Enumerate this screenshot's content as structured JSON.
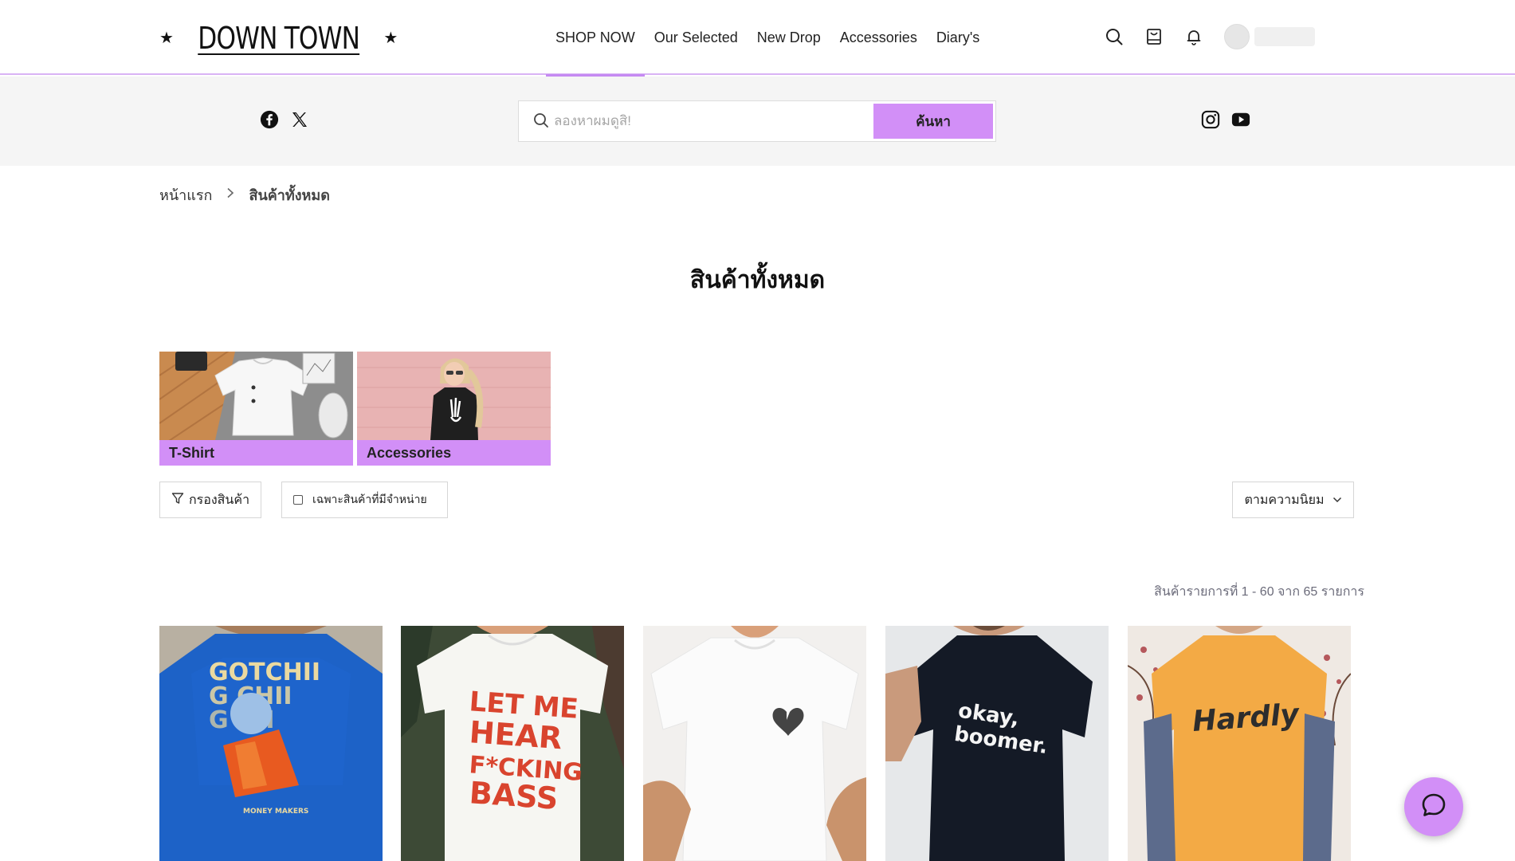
{
  "brand": {
    "logo_text": "DOWN TOWN",
    "star": "★"
  },
  "nav": {
    "items": [
      {
        "label": "SHOP NOW",
        "active": true
      },
      {
        "label": "Our Selected",
        "active": false
      },
      {
        "label": "New Drop",
        "active": false
      },
      {
        "label": "Accessories",
        "active": false
      },
      {
        "label": "Diary's",
        "active": false
      }
    ],
    "accent": "#c58af2"
  },
  "header_icons": [
    "search-icon",
    "cart-icon",
    "bell-icon"
  ],
  "search": {
    "placeholder": "ลองหาผมดูสิ!",
    "button_label": "ค้นหา"
  },
  "social": {
    "left": [
      "facebook-icon",
      "x-icon"
    ],
    "right": [
      "instagram-icon",
      "youtube-icon"
    ]
  },
  "breadcrumb": {
    "home": "หน้าแรก",
    "current": "สินค้าทั้งหมด"
  },
  "page_title": "สินค้าทั้งหมด",
  "categories": [
    {
      "label": "T-Shirt"
    },
    {
      "label": "Accessories"
    }
  ],
  "filters": {
    "filter_label": "กรองสินค้า",
    "in_stock_label": "เฉพาะสินค้าที่มีจำหน่าย",
    "sort_label": "ตามความนิยม"
  },
  "result_count": "สินค้ารายการที่ 1 - 60 จาก 65 รายการ",
  "products": [
    {
      "image": "blue-gotchii-tee",
      "print": "GOTCHII"
    },
    {
      "image": "white-bass-tee",
      "print": "LET ME HEAR BASS"
    },
    {
      "image": "white-heart-tee",
      "print": ""
    },
    {
      "image": "black-okay-boomer-tee",
      "print": "okay, boomer."
    },
    {
      "image": "yellow-hardly-tee",
      "print": "Hardly"
    }
  ],
  "colors": {
    "accent": "#d28ff7",
    "band_bg": "#f5f5f5",
    "border": "#d9b3f5"
  }
}
